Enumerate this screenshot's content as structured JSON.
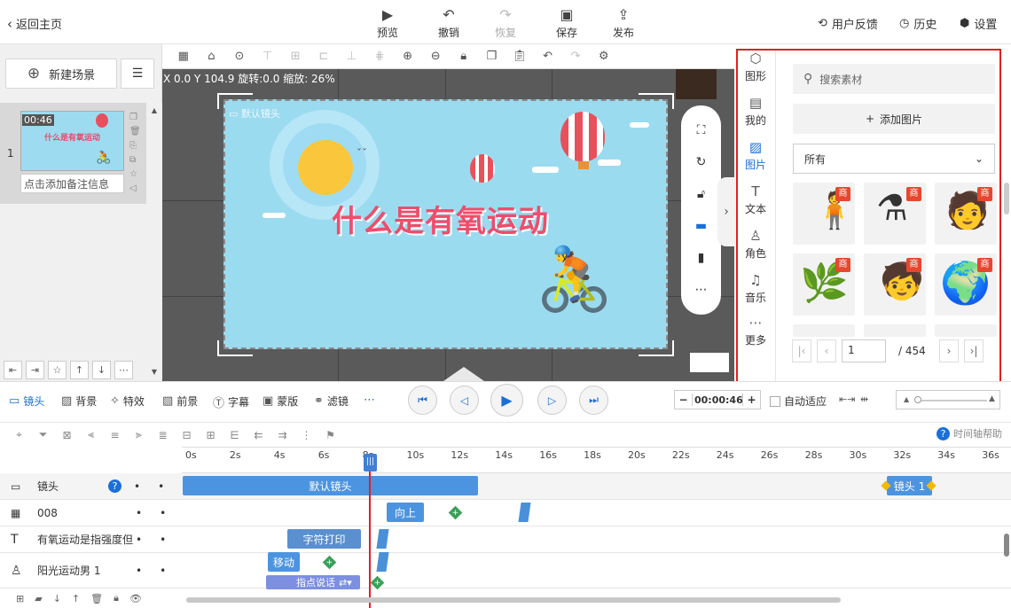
{
  "topbar": {
    "back": "返回主页",
    "preview": "预览",
    "undo": "撤销",
    "redo": "恢复",
    "save": "保存",
    "publish": "发布",
    "feedback": "用户反馈",
    "history": "历史",
    "settings": "设置"
  },
  "left": {
    "new_scene": "新建场景",
    "scene_number": "1",
    "scene_time": "00:46",
    "scene_note": "点击添加备注信息",
    "thumb_title": "什么是有氧运动"
  },
  "canvas": {
    "coords": "X 0.0  Y 104.9  旋转:0.0  缩放: 26%",
    "camera_label": "默认镜头",
    "title_text": "什么是有氧运动"
  },
  "right": {
    "cats": [
      {
        "label": "图形",
        "icon": "shape-icon"
      },
      {
        "label": "我的",
        "icon": "my-icon"
      },
      {
        "label": "图片",
        "icon": "image-icon"
      },
      {
        "label": "文本",
        "icon": "text-icon"
      },
      {
        "label": "角色",
        "icon": "character-icon"
      },
      {
        "label": "音乐",
        "icon": "music-icon"
      },
      {
        "label": "更多",
        "icon": "more-icon"
      }
    ],
    "search_placeholder": "搜索素材",
    "add_image": "添加图片",
    "filter": "所有",
    "badge": "商",
    "page": "1",
    "total": "/ 454"
  },
  "tabs": {
    "camera": "镜头",
    "background": "背景",
    "effects": "特效",
    "foreground": "前景",
    "subtitle": "字幕",
    "mask": "蒙版",
    "filter": "滤镜"
  },
  "time": {
    "current": "00:00:46.0",
    "auto_fit": "自动适应",
    "help": "时间轴帮助"
  },
  "ruler": [
    "0s",
    "2s",
    "4s",
    "6s",
    "8s",
    "10s",
    "12s",
    "14s",
    "16s",
    "18s",
    "20s",
    "22s",
    "24s",
    "26s",
    "28s",
    "30s",
    "32s",
    "34s",
    "36s"
  ],
  "tracks": {
    "camera": "镜头",
    "t1": "008",
    "t2": "有氧运动是指强度但",
    "t3": "阳光运动男 1"
  },
  "clips": {
    "default_camera": "默认镜头",
    "camera1": "镜头 1",
    "up": "向上",
    "typing": "字符打印",
    "move": "移动",
    "point": "指点说话"
  }
}
